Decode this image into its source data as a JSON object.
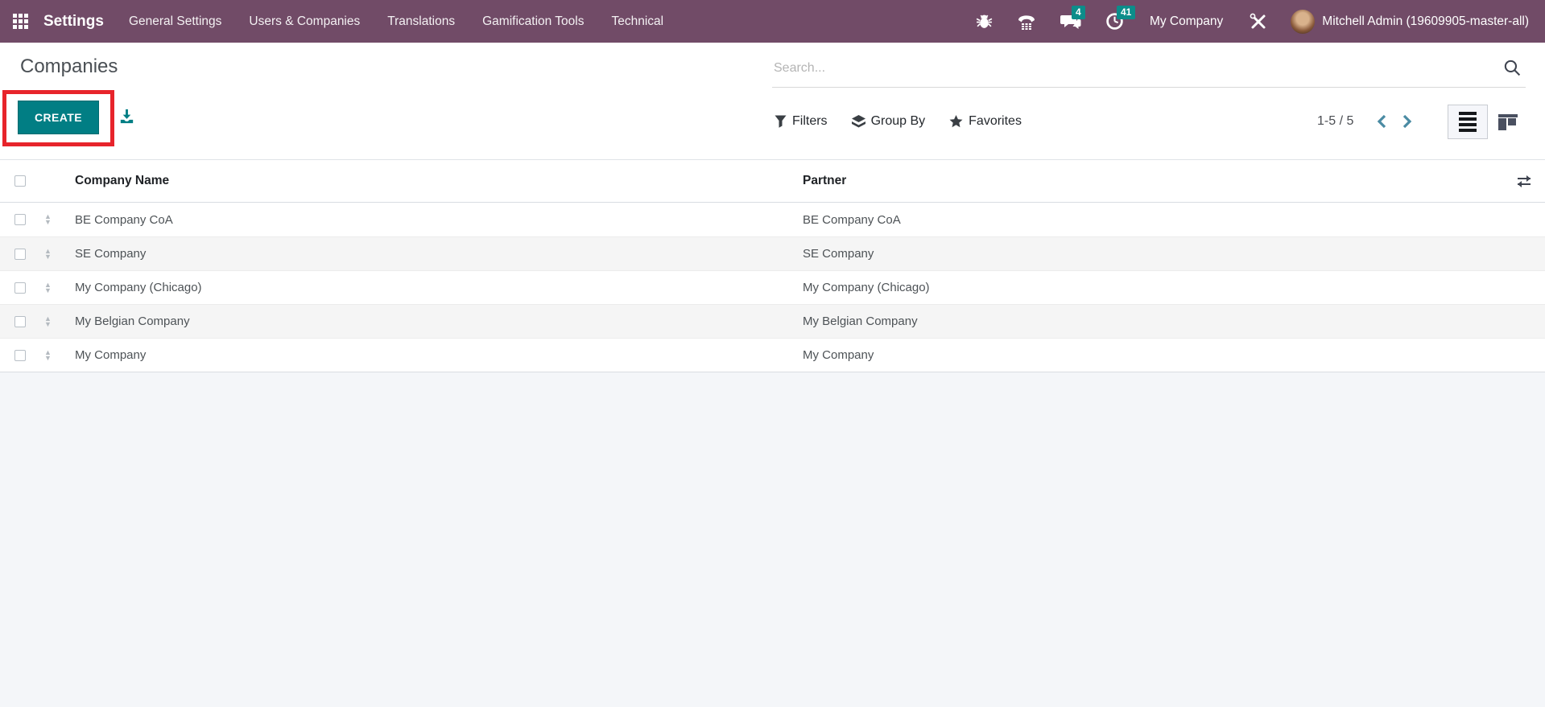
{
  "navbar": {
    "app_name": "Settings",
    "menu_items": {
      "general_settings": "General Settings",
      "users_companies": "Users & Companies",
      "translations": "Translations",
      "gamification_tools": "Gamification Tools",
      "technical": "Technical"
    },
    "systray": {
      "messages_count": "4",
      "activities_count": "41",
      "company": "My Company",
      "user": "Mitchell Admin (19609905-master-all)"
    }
  },
  "control_panel": {
    "title": "Companies",
    "create_label": "CREATE",
    "search_placeholder": "Search...",
    "filters_label": "Filters",
    "group_by_label": "Group By",
    "favorites_label": "Favorites",
    "pager": "1-5 / 5"
  },
  "table": {
    "columns": {
      "name": "Company Name",
      "partner": "Partner"
    },
    "rows": [
      {
        "name": "BE Company CoA",
        "partner": "BE Company CoA"
      },
      {
        "name": "SE Company",
        "partner": "SE Company"
      },
      {
        "name": "My Company (Chicago)",
        "partner": "My Company (Chicago)"
      },
      {
        "name": "My Belgian Company",
        "partner": "My Belgian Company"
      },
      {
        "name": "My Company",
        "partner": "My Company"
      }
    ]
  },
  "colors": {
    "navbar_bg": "#714B67",
    "accent_teal": "#017e84",
    "badge_teal": "#0c8d8a",
    "highlight_red": "#e7242b"
  }
}
